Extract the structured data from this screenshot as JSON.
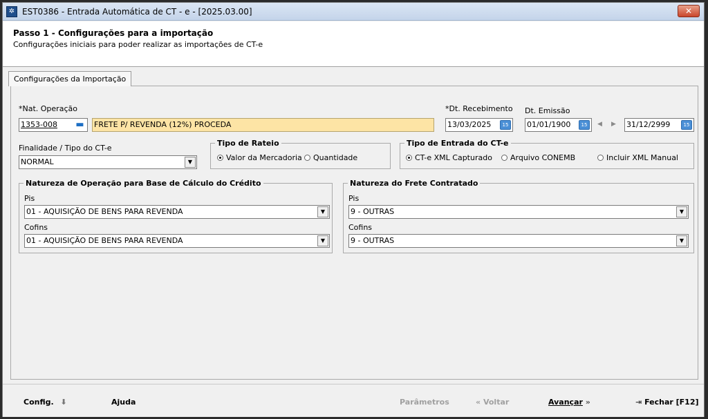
{
  "window": {
    "title": "EST0386 - Entrada Automática de CT - e - [2025.03.00]",
    "close_label": "✕"
  },
  "header": {
    "step_title": "Passo 1 - Configurações para a importação",
    "step_subtitle": "Configurações iniciais para poder realizar as importações de CT-e"
  },
  "tabs": [
    {
      "label": "Configurações da Importação",
      "active": true
    }
  ],
  "form": {
    "nat_operacao": {
      "label": "Nat. Operação",
      "required": true,
      "code": "1353-008",
      "description": "FRETE P/ REVENDA (12%) PROCEDA"
    },
    "dt_recebimento": {
      "label": "Dt. Recebimento",
      "required": true,
      "value": "13/03/2025"
    },
    "dt_emissao": {
      "label": "Dt. Emissão",
      "from": "01/01/1900",
      "to": "31/12/2999"
    },
    "finalidade": {
      "label": "Finalidade / Tipo do CT-e",
      "value": "NORMAL"
    },
    "tipo_rateio": {
      "legend": "Tipo de Rateio",
      "options": [
        "Valor da Mercadoria",
        "Quantidade"
      ],
      "selected": "Valor da Mercadoria"
    },
    "tipo_entrada": {
      "legend": "Tipo de Entrada do CT-e",
      "options": [
        "CT-e XML Capturado",
        "Arquivo CONEMB",
        "Incluir XML Manual"
      ],
      "selected": "CT-e XML Capturado"
    },
    "natureza_base": {
      "legend": "Natureza de Operação para Base de Cálculo do Crédito",
      "pis_label": "Pis",
      "pis_value": "01 - AQUISIÇÃO DE BENS PARA REVENDA",
      "cofins_label": "Cofins",
      "cofins_value": "01 - AQUISIÇÃO DE BENS PARA REVENDA"
    },
    "natureza_frete": {
      "legend": "Natureza do Frete Contratado",
      "pis_label": "Pis",
      "pis_value": "9 - OUTRAS",
      "cofins_label": "Cofins",
      "cofins_value": "9 - OUTRAS"
    }
  },
  "footer": {
    "config": "Config.",
    "ajuda": "Ajuda",
    "parametros": "Parâmetros",
    "voltar": "Voltar",
    "avancar": "Avançar",
    "fechar": "Fechar [F12]"
  },
  "icons": {
    "calendar": "calendar-icon",
    "lookup": "folder-lookup-icon",
    "dropdown": "chevron-down-icon"
  },
  "colors": {
    "required_field_bg": "#fde4a5",
    "calendar_button": "#4a8fd6",
    "close_button": "#c9462c"
  }
}
